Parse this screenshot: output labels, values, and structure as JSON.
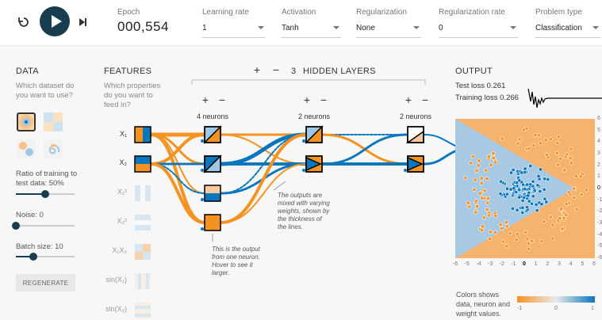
{
  "controls": {
    "reset_icon": "reset-icon",
    "play_icon": "play-icon",
    "step_icon": "step-icon"
  },
  "epoch": {
    "label": "Epoch",
    "value": "000,554"
  },
  "learning_rate": {
    "label": "Learning rate",
    "value": "1"
  },
  "activation": {
    "label": "Activation",
    "value": "Tanh"
  },
  "regularization": {
    "label": "Regularization",
    "value": "None"
  },
  "reg_rate": {
    "label": "Regularization rate",
    "value": "0"
  },
  "problem_type": {
    "label": "Problem type",
    "value": "Classification"
  },
  "data": {
    "title": "DATA",
    "subtitle_line1": "Which dataset do",
    "subtitle_line2": "you want to use?",
    "ratio_line1": "Ratio of training to",
    "ratio_line2": "test data:  50%",
    "ratio_value": 0.5,
    "noise_label": "Noise:  0",
    "noise_value": 0,
    "batch_label": "Batch size:  10",
    "batch_value": 0.3,
    "regenerate": "REGENERATE"
  },
  "features": {
    "title": "FEATURES",
    "sub1": "Which properties",
    "sub2": "do you want to",
    "sub3": "feed in?",
    "items": [
      {
        "label": "X₁"
      },
      {
        "label": "X₂"
      },
      {
        "label": "X₁²"
      },
      {
        "label": "X₂²"
      },
      {
        "label": "X₁X₂"
      },
      {
        "label": "sin(X₁)"
      },
      {
        "label": "sin(X₂)"
      }
    ]
  },
  "network": {
    "layers_count": "3",
    "layers_title": "HIDDEN LAYERS",
    "layer_labels": [
      "4 neurons",
      "2 neurons",
      "2 neurons"
    ],
    "note1_l1": "The outputs are",
    "note1_l2": "mixed with varying",
    "note1_l3": "weights, shown by",
    "note1_l4": "the thickness of",
    "note1_l5": "the lines.",
    "note2_l1": "This is the output",
    "note2_l2": "from one neuron.",
    "note2_l3": "Hover to see it",
    "note2_l4": "larger."
  },
  "output": {
    "title": "OUTPUT",
    "test_loss": "Test loss 0.261",
    "training_loss": "Training loss 0.266",
    "x_ticks": [
      "-6",
      "-5",
      "-4",
      "-3",
      "-2",
      "-1",
      "0",
      "1",
      "2",
      "3",
      "4",
      "5",
      "6"
    ],
    "y_ticks": [
      "6",
      "5",
      "4",
      "3",
      "2",
      "1",
      "0",
      "-1",
      "-2",
      "-3",
      "-4",
      "-5",
      "-6"
    ],
    "legend_l1": "Colors shows",
    "legend_l2": "data, neuron and",
    "legend_l3": "weight values.",
    "legend_ticks": [
      "-1",
      "0",
      "1"
    ]
  },
  "colors": {
    "orange": "#f59322",
    "blue": "#0877bd",
    "dark": "#183d4e"
  }
}
